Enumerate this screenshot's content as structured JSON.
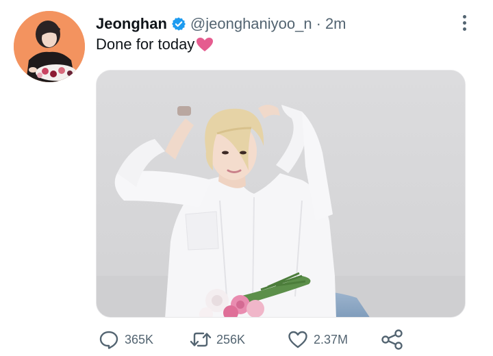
{
  "tweet": {
    "author_name": "Jeonghan",
    "handle": "@jeonghaniyoo_n",
    "separator": "·",
    "time": "2m",
    "text": "Done for today",
    "verified": true
  },
  "icons": {
    "verified": "verified-badge-icon",
    "more": "more-vertical-icon",
    "text_emoji": "pink-heart-emoji",
    "reply": "reply-icon",
    "retweet": "retweet-icon",
    "like": "heart-icon",
    "share": "share-icon"
  },
  "actions": {
    "reply_count": "365K",
    "retweet_count": "256K",
    "like_count": "2.37M"
  },
  "colors": {
    "text_primary": "#0f1419",
    "text_secondary": "#536471",
    "verified_blue": "#1d9bf0",
    "emoji_pink": "#e55c8f",
    "avatar_bg": "#f48f5f"
  }
}
